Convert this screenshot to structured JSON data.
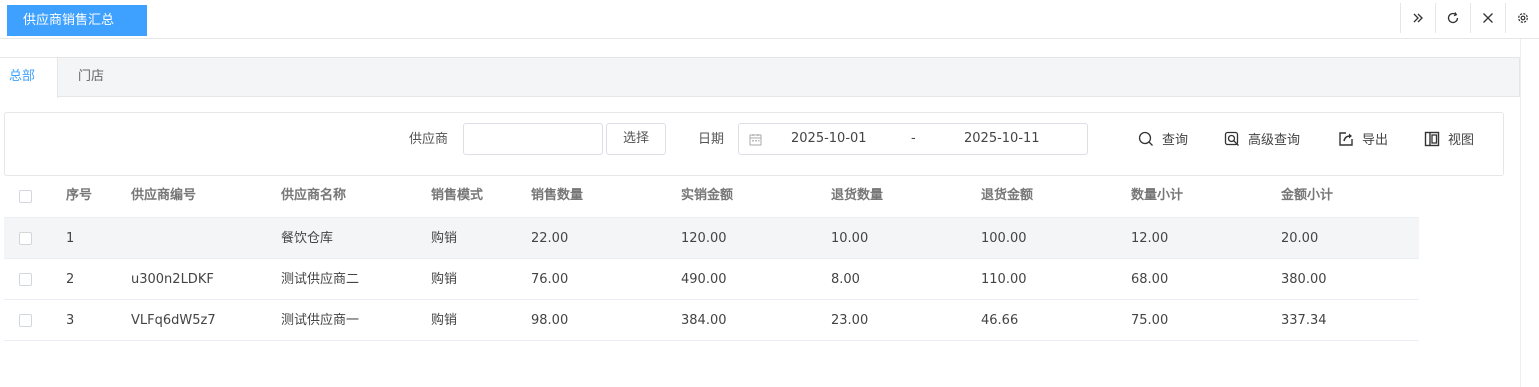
{
  "app": {
    "page_tab": "供应商销售汇总"
  },
  "top_actions": [
    {
      "name": "expand-icon"
    },
    {
      "name": "refresh-icon"
    },
    {
      "name": "close-icon"
    },
    {
      "name": "settings-icon"
    }
  ],
  "subtabs": {
    "active": "总部",
    "second": "门店"
  },
  "filter": {
    "supplier_label": "供应商",
    "supplier_value": "",
    "select_button": "选择",
    "date_label": "日期",
    "date_start": "2025-10-01",
    "date_sep": "-",
    "date_end": "2025-10-11",
    "query": "查询",
    "advanced_query": "高级查询",
    "export": "导出",
    "view": "视图"
  },
  "table": {
    "headers": [
      "序号",
      "供应商编号",
      "供应商名称",
      "销售模式",
      "销售数量",
      "实销金额",
      "退货数量",
      "退货金额",
      "数量小计",
      "金额小计"
    ],
    "rows": [
      [
        "1",
        "",
        "餐饮仓库",
        "购销",
        "22.00",
        "120.00",
        "10.00",
        "100.00",
        "12.00",
        "20.00"
      ],
      [
        "2",
        "u300n2LDKF",
        "测试供应商二",
        "购销",
        "76.00",
        "490.00",
        "8.00",
        "110.00",
        "68.00",
        "380.00"
      ],
      [
        "3",
        "VLFq6dW5z7",
        "测试供应商一",
        "购销",
        "98.00",
        "384.00",
        "23.00",
        "46.66",
        "75.00",
        "337.34"
      ]
    ]
  },
  "colors": {
    "accent": "#3ea1ff",
    "row_highlight": "#f4f5f7",
    "border": "#e6e6e6"
  }
}
